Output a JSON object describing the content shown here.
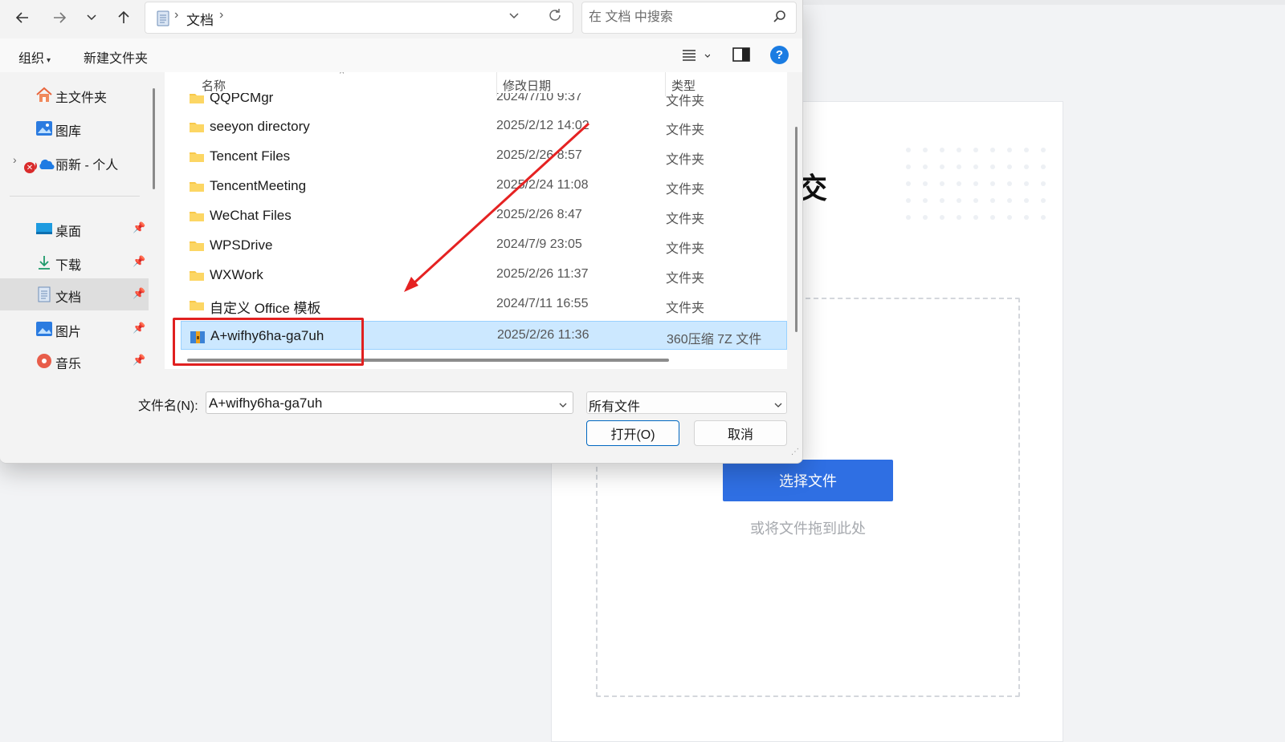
{
  "page": {
    "heading_fragment": "交",
    "select_button": "选择文件",
    "drag_hint": "或将文件拖到此处"
  },
  "dialog": {
    "address": {
      "crumb": "文档"
    },
    "search": {
      "placeholder": "在 文档 中搜索"
    },
    "commands": {
      "organize": "组织",
      "new_folder": "新建文件夹",
      "help": "?"
    },
    "nav": [
      {
        "label": "主文件夹",
        "icon": "home-icon"
      },
      {
        "label": "图库",
        "icon": "gallery-icon"
      },
      {
        "label": "丽新 - 个人",
        "icon": "onedrive-icon"
      },
      {
        "label": "桌面",
        "icon": "desktop-icon",
        "pinned": true
      },
      {
        "label": "下载",
        "icon": "download-icon",
        "pinned": true
      },
      {
        "label": "文档",
        "icon": "document-icon",
        "pinned": true,
        "selected": true
      },
      {
        "label": "图片",
        "icon": "pictures-icon",
        "pinned": true
      },
      {
        "label": "音乐",
        "icon": "music-icon",
        "pinned": true
      }
    ],
    "columns": {
      "name": "名称",
      "date": "修改日期",
      "type": "类型"
    },
    "files": [
      {
        "name": "QQPCMgr",
        "date": "2024/7/10 9:37",
        "type": "文件夹",
        "icon": "folder-icon"
      },
      {
        "name": "seeyon directory",
        "date": "2025/2/12 14:02",
        "type": "文件夹",
        "icon": "folder-icon"
      },
      {
        "name": "Tencent Files",
        "date": "2025/2/26 8:57",
        "type": "文件夹",
        "icon": "folder-icon"
      },
      {
        "name": "TencentMeeting",
        "date": "2025/2/24 11:08",
        "type": "文件夹",
        "icon": "folder-icon"
      },
      {
        "name": "WeChat Files",
        "date": "2025/2/26 8:47",
        "type": "文件夹",
        "icon": "folder-icon"
      },
      {
        "name": "WPSDrive",
        "date": "2024/7/9 23:05",
        "type": "文件夹",
        "icon": "folder-icon"
      },
      {
        "name": "WXWork",
        "date": "2025/2/26 11:37",
        "type": "文件夹",
        "icon": "folder-icon"
      },
      {
        "name": "自定义 Office 模板",
        "date": "2024/7/11 16:55",
        "type": "文件夹",
        "icon": "folder-icon"
      },
      {
        "name": "A+wifhy6ha-ga7uh",
        "date": "2025/2/26 11:36",
        "type": "360压缩 7Z 文件",
        "icon": "archive-icon",
        "selected": true
      }
    ],
    "filename_label": "文件名(N):",
    "filename_value": "A+wifhy6ha-ga7uh",
    "filetype_value": "所有文件",
    "open_button": "打开(O)",
    "cancel_button": "取消"
  },
  "colors": {
    "accent_blue": "#2f6fe3",
    "selection": "#cce8ff",
    "annotation_red": "#e02020",
    "folder": "#f8c84a"
  }
}
